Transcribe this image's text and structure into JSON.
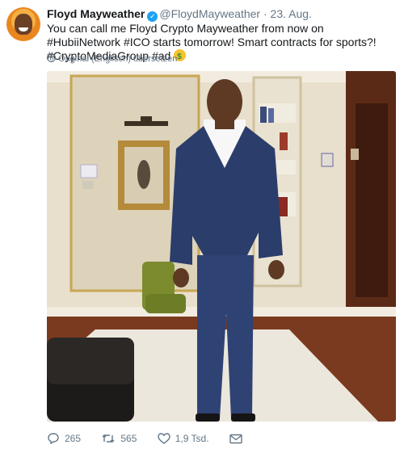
{
  "tweet": {
    "author_name": "Floyd Mayweather",
    "handle": "@FloydMayweather",
    "separator": "·",
    "date": "23. Aug.",
    "text_part1": "You can call me Floyd Crypto Mayweather from now on ",
    "hashtag1": "#HubiiNetwork",
    "text_part2": " ",
    "hashtag2": "#ICO",
    "text_part3": " starts tomorrow! Smart contracts for sports?!  ",
    "hashtag3": "#CryptoMediaGroup",
    "text_part4": " ",
    "hashtag4": "#ad",
    "emoji": "money-mouth-face",
    "translate_label": "Original (Englisch) übersetzen"
  },
  "actions": {
    "reply_count": "265",
    "retweet_count": "565",
    "like_count": "1,9 Tsd."
  },
  "colors": {
    "verified": "#1da1f2",
    "muted": "#657786",
    "text": "#14171a",
    "suit": "#2b3d6b",
    "wall": "#e7ddc9",
    "floor": "#7a3a1f"
  }
}
